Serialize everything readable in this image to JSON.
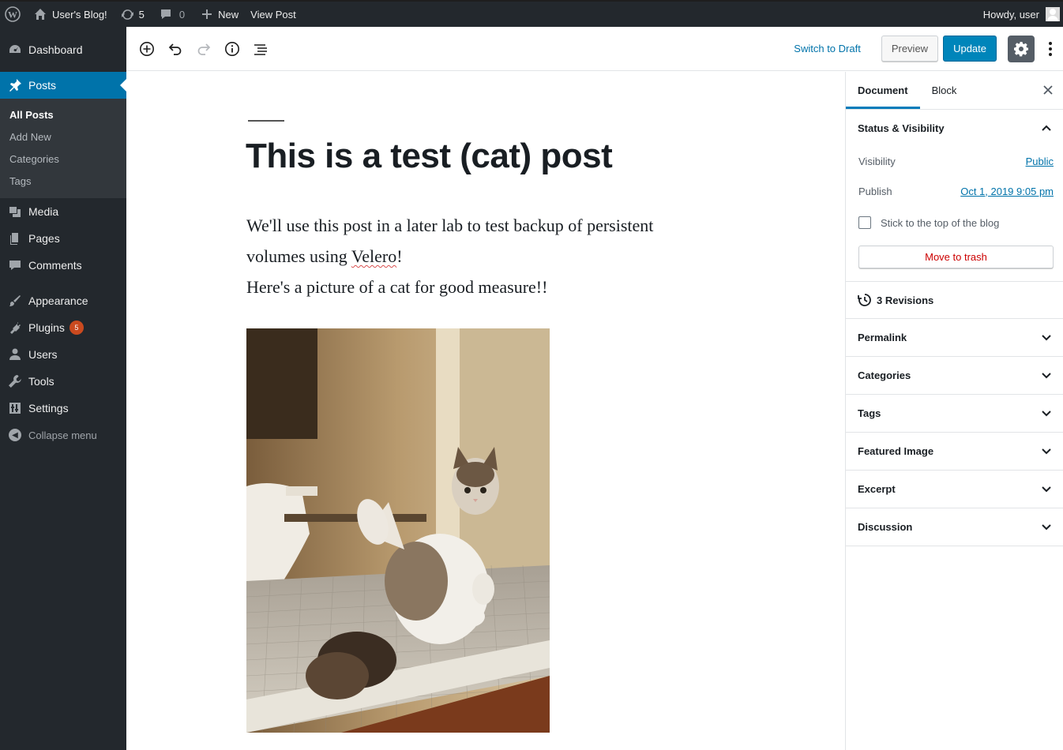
{
  "admin_bar": {
    "site_name": "User's Blog!",
    "updates_count": "5",
    "comments_count": "0",
    "new_label": "New",
    "view_post_label": "View Post",
    "greeting": "Howdy, user"
  },
  "sidebar": {
    "dashboard": "Dashboard",
    "posts": "Posts",
    "posts_sub": [
      "All Posts",
      "Add New",
      "Categories",
      "Tags"
    ],
    "media": "Media",
    "pages": "Pages",
    "comments": "Comments",
    "appearance": "Appearance",
    "plugins": "Plugins",
    "plugins_badge": "5",
    "users": "Users",
    "tools": "Tools",
    "settings": "Settings",
    "collapse": "Collapse menu"
  },
  "toolbar": {
    "switch_to_draft": "Switch to Draft",
    "preview": "Preview",
    "update": "Update"
  },
  "post": {
    "title": "This is a test (cat) post",
    "para1_a": "We'll use this post in a later lab to test backup of persistent volumes using ",
    "para1_link": "Velero",
    "para1_b": "!",
    "para2": "Here's a picture of a cat for good measure!!"
  },
  "panel": {
    "tab_document": "Document",
    "tab_block": "Block",
    "status_visibility": "Status & Visibility",
    "visibility_label": "Visibility",
    "visibility_value": "Public",
    "publish_label": "Publish",
    "publish_value": "Oct 1, 2019 9:05 pm",
    "sticky_label": "Stick to the top of the blog",
    "move_to_trash": "Move to trash",
    "revisions": "3 Revisions",
    "sections": [
      "Permalink",
      "Categories",
      "Tags",
      "Featured Image",
      "Excerpt",
      "Discussion"
    ]
  },
  "colors": {
    "admin_dark": "#23282d",
    "accent_blue": "#0073aa",
    "update_button": "#0085ba",
    "trash_red": "#cc0000",
    "badge_orange": "#ca4a1f"
  }
}
